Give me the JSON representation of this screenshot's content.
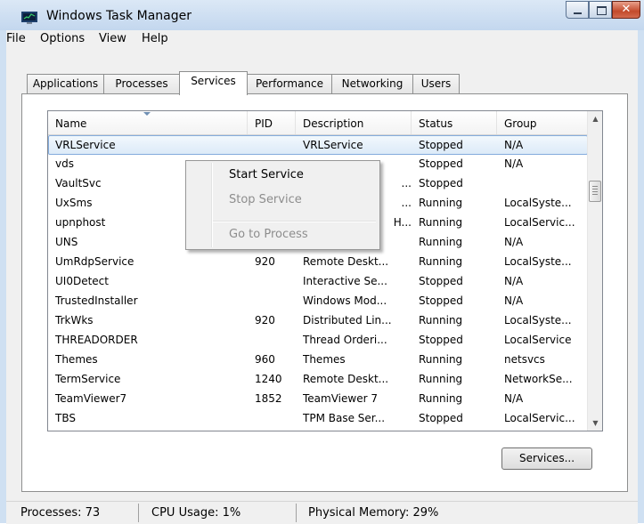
{
  "window": {
    "title": "Windows Task Manager",
    "min_symbol": "",
    "max_symbol": "",
    "close_symbol": "✕"
  },
  "menu": [
    "File",
    "Options",
    "View",
    "Help"
  ],
  "tabs": [
    {
      "label": "Applications",
      "active": false
    },
    {
      "label": "Processes",
      "active": false
    },
    {
      "label": "Services",
      "active": true
    },
    {
      "label": "Performance",
      "active": false
    },
    {
      "label": "Networking",
      "active": false
    },
    {
      "label": "Users",
      "active": false
    }
  ],
  "columns": [
    "Name",
    "PID",
    "Description",
    "Status",
    "Group"
  ],
  "rows": [
    {
      "name": "VRLService",
      "pid": "",
      "description": "VRLService",
      "status": "Stopped",
      "group": "N/A",
      "selected": true
    },
    {
      "name": "vds",
      "pid": "",
      "description": "",
      "status": "Stopped",
      "group": "N/A"
    },
    {
      "name": "VaultSvc",
      "pid": "",
      "description": "...",
      "status": "Stopped",
      "group": ""
    },
    {
      "name": "UxSms",
      "pid": "",
      "description": "...",
      "status": "Running",
      "group": "LocalSyste..."
    },
    {
      "name": "upnphost",
      "pid": "",
      "description": "H...",
      "status": "Running",
      "group": "LocalServic..."
    },
    {
      "name": "UNS",
      "pid": "",
      "description": "",
      "status": "Running",
      "group": "N/A"
    },
    {
      "name": "UmRdpService",
      "pid": "920",
      "description": "Remote Deskt...",
      "status": "Running",
      "group": "LocalSyste..."
    },
    {
      "name": "UI0Detect",
      "pid": "",
      "description": "Interactive Se...",
      "status": "Stopped",
      "group": "N/A"
    },
    {
      "name": "TrustedInstaller",
      "pid": "",
      "description": "Windows Mod...",
      "status": "Stopped",
      "group": "N/A"
    },
    {
      "name": "TrkWks",
      "pid": "920",
      "description": "Distributed Lin...",
      "status": "Running",
      "group": "LocalSyste..."
    },
    {
      "name": "THREADORDER",
      "pid": "",
      "description": "Thread Orderi...",
      "status": "Stopped",
      "group": "LocalService"
    },
    {
      "name": "Themes",
      "pid": "960",
      "description": "Themes",
      "status": "Running",
      "group": "netsvcs"
    },
    {
      "name": "TermService",
      "pid": "1240",
      "description": "Remote Deskt...",
      "status": "Running",
      "group": "NetworkSe..."
    },
    {
      "name": "TeamViewer7",
      "pid": "1852",
      "description": "TeamViewer 7",
      "status": "Running",
      "group": "N/A"
    },
    {
      "name": "TBS",
      "pid": "",
      "description": "TPM Base Ser...",
      "status": "Stopped",
      "group": "LocalServic..."
    }
  ],
  "context_menu": [
    {
      "label": "Start Service",
      "enabled": true
    },
    {
      "label": "Stop Service",
      "enabled": false
    },
    {
      "label": "Go to Process",
      "enabled": false
    }
  ],
  "services_button": "Services...",
  "scrollbar": {
    "up": "▲",
    "down": "▼"
  },
  "status": {
    "processes": "Processes: 73",
    "cpu": "CPU Usage: 1%",
    "memory": "Physical Memory: 29%"
  }
}
